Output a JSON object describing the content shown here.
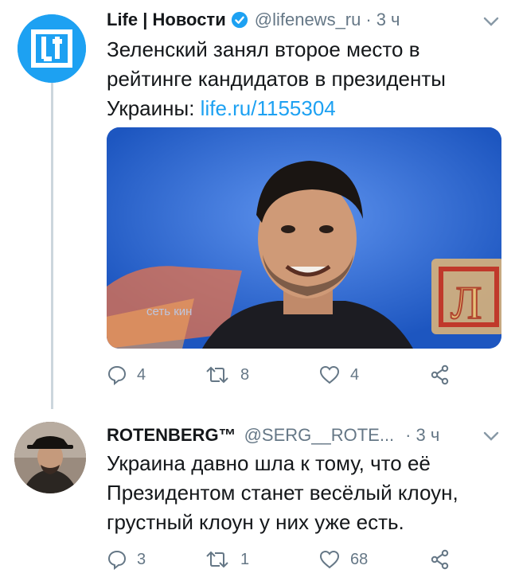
{
  "tweets": [
    {
      "name": "Life | Новости",
      "handle": "@lifenews_ru",
      "separator": "·",
      "time": "3 ч",
      "text": "Зеленский занял второе место в рейтинге кандидатов в президенты Украины:",
      "link": "life.ru/1155304",
      "media_caption": "сеть кин",
      "media_letter": "Л",
      "actions": {
        "replies": "4",
        "retweets": "8",
        "likes": "4"
      }
    },
    {
      "name": "ROTENBERG™",
      "handle": "@SERG__ROTE...",
      "separator": "·",
      "time": "3 ч",
      "text": "Украина давно шла к тому, что её Президентом станет весёлый клоун, грустный клоун у них уже есть.",
      "actions": {
        "replies": "3",
        "retweets": "1",
        "likes": "68"
      }
    }
  ],
  "colors": {
    "link": "#1da1f2",
    "muted": "#657786",
    "thread_line": "#ccd6dd",
    "verified": "#1da1f2"
  },
  "icons": [
    "life-logo-icon",
    "verified-badge-icon",
    "chevron-down-icon",
    "reply-icon",
    "retweet-icon",
    "like-icon",
    "share-icon"
  ]
}
